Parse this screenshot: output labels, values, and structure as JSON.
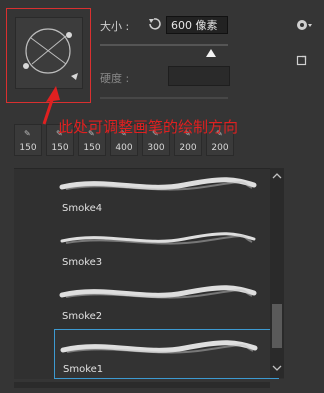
{
  "controls": {
    "size_label": "大小 :",
    "size_value": "600 像素",
    "hardness_label": "硬度 :",
    "angle_annotation": "此处可调整画笔的绘制方向",
    "slider_fraction": 0.87
  },
  "recent_brushes": [
    {
      "size": "150"
    },
    {
      "size": "150"
    },
    {
      "size": "150"
    },
    {
      "size": "400"
    },
    {
      "size": "300"
    },
    {
      "size": "200"
    },
    {
      "size": "200"
    }
  ],
  "brush_list": [
    {
      "name": "Smoke4"
    },
    {
      "name": "Smoke3"
    },
    {
      "name": "Smoke2"
    },
    {
      "name": "Smoke1"
    }
  ],
  "icons": [
    "gear-icon",
    "reset-icon",
    "new-preset-icon",
    "brush-stroke-icon",
    "chevron-up-icon",
    "chevron-down-icon"
  ]
}
